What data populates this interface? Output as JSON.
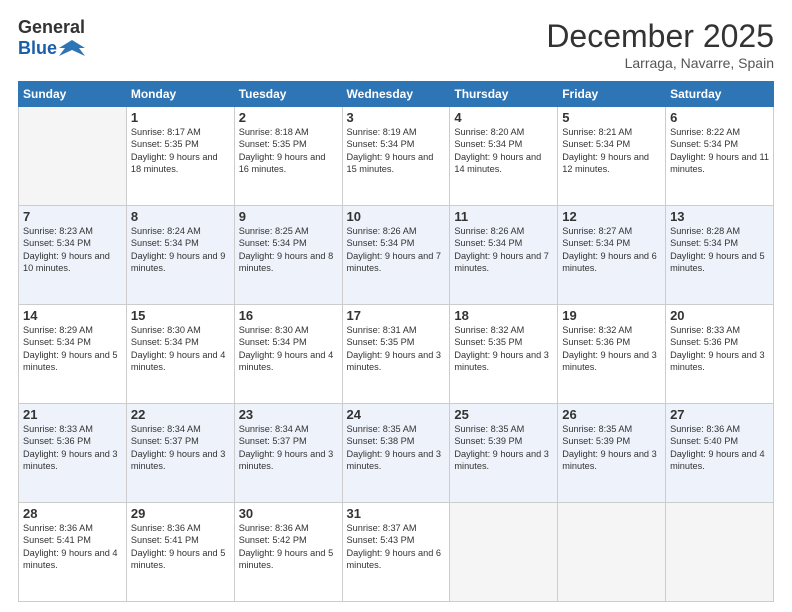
{
  "header": {
    "logo_general": "General",
    "logo_blue": "Blue",
    "month": "December 2025",
    "location": "Larraga, Navarre, Spain"
  },
  "weekdays": [
    "Sunday",
    "Monday",
    "Tuesday",
    "Wednesday",
    "Thursday",
    "Friday",
    "Saturday"
  ],
  "weeks": [
    [
      {
        "day": "",
        "sunrise": "",
        "sunset": "",
        "daylight": ""
      },
      {
        "day": "1",
        "sunrise": "Sunrise: 8:17 AM",
        "sunset": "Sunset: 5:35 PM",
        "daylight": "Daylight: 9 hours and 18 minutes."
      },
      {
        "day": "2",
        "sunrise": "Sunrise: 8:18 AM",
        "sunset": "Sunset: 5:35 PM",
        "daylight": "Daylight: 9 hours and 16 minutes."
      },
      {
        "day": "3",
        "sunrise": "Sunrise: 8:19 AM",
        "sunset": "Sunset: 5:34 PM",
        "daylight": "Daylight: 9 hours and 15 minutes."
      },
      {
        "day": "4",
        "sunrise": "Sunrise: 8:20 AM",
        "sunset": "Sunset: 5:34 PM",
        "daylight": "Daylight: 9 hours and 14 minutes."
      },
      {
        "day": "5",
        "sunrise": "Sunrise: 8:21 AM",
        "sunset": "Sunset: 5:34 PM",
        "daylight": "Daylight: 9 hours and 12 minutes."
      },
      {
        "day": "6",
        "sunrise": "Sunrise: 8:22 AM",
        "sunset": "Sunset: 5:34 PM",
        "daylight": "Daylight: 9 hours and 11 minutes."
      }
    ],
    [
      {
        "day": "7",
        "sunrise": "Sunrise: 8:23 AM",
        "sunset": "Sunset: 5:34 PM",
        "daylight": "Daylight: 9 hours and 10 minutes."
      },
      {
        "day": "8",
        "sunrise": "Sunrise: 8:24 AM",
        "sunset": "Sunset: 5:34 PM",
        "daylight": "Daylight: 9 hours and 9 minutes."
      },
      {
        "day": "9",
        "sunrise": "Sunrise: 8:25 AM",
        "sunset": "Sunset: 5:34 PM",
        "daylight": "Daylight: 9 hours and 8 minutes."
      },
      {
        "day": "10",
        "sunrise": "Sunrise: 8:26 AM",
        "sunset": "Sunset: 5:34 PM",
        "daylight": "Daylight: 9 hours and 7 minutes."
      },
      {
        "day": "11",
        "sunrise": "Sunrise: 8:26 AM",
        "sunset": "Sunset: 5:34 PM",
        "daylight": "Daylight: 9 hours and 7 minutes."
      },
      {
        "day": "12",
        "sunrise": "Sunrise: 8:27 AM",
        "sunset": "Sunset: 5:34 PM",
        "daylight": "Daylight: 9 hours and 6 minutes."
      },
      {
        "day": "13",
        "sunrise": "Sunrise: 8:28 AM",
        "sunset": "Sunset: 5:34 PM",
        "daylight": "Daylight: 9 hours and 5 minutes."
      }
    ],
    [
      {
        "day": "14",
        "sunrise": "Sunrise: 8:29 AM",
        "sunset": "Sunset: 5:34 PM",
        "daylight": "Daylight: 9 hours and 5 minutes."
      },
      {
        "day": "15",
        "sunrise": "Sunrise: 8:30 AM",
        "sunset": "Sunset: 5:34 PM",
        "daylight": "Daylight: 9 hours and 4 minutes."
      },
      {
        "day": "16",
        "sunrise": "Sunrise: 8:30 AM",
        "sunset": "Sunset: 5:34 PM",
        "daylight": "Daylight: 9 hours and 4 minutes."
      },
      {
        "day": "17",
        "sunrise": "Sunrise: 8:31 AM",
        "sunset": "Sunset: 5:35 PM",
        "daylight": "Daylight: 9 hours and 3 minutes."
      },
      {
        "day": "18",
        "sunrise": "Sunrise: 8:32 AM",
        "sunset": "Sunset: 5:35 PM",
        "daylight": "Daylight: 9 hours and 3 minutes."
      },
      {
        "day": "19",
        "sunrise": "Sunrise: 8:32 AM",
        "sunset": "Sunset: 5:36 PM",
        "daylight": "Daylight: 9 hours and 3 minutes."
      },
      {
        "day": "20",
        "sunrise": "Sunrise: 8:33 AM",
        "sunset": "Sunset: 5:36 PM",
        "daylight": "Daylight: 9 hours and 3 minutes."
      }
    ],
    [
      {
        "day": "21",
        "sunrise": "Sunrise: 8:33 AM",
        "sunset": "Sunset: 5:36 PM",
        "daylight": "Daylight: 9 hours and 3 minutes."
      },
      {
        "day": "22",
        "sunrise": "Sunrise: 8:34 AM",
        "sunset": "Sunset: 5:37 PM",
        "daylight": "Daylight: 9 hours and 3 minutes."
      },
      {
        "day": "23",
        "sunrise": "Sunrise: 8:34 AM",
        "sunset": "Sunset: 5:37 PM",
        "daylight": "Daylight: 9 hours and 3 minutes."
      },
      {
        "day": "24",
        "sunrise": "Sunrise: 8:35 AM",
        "sunset": "Sunset: 5:38 PM",
        "daylight": "Daylight: 9 hours and 3 minutes."
      },
      {
        "day": "25",
        "sunrise": "Sunrise: 8:35 AM",
        "sunset": "Sunset: 5:39 PM",
        "daylight": "Daylight: 9 hours and 3 minutes."
      },
      {
        "day": "26",
        "sunrise": "Sunrise: 8:35 AM",
        "sunset": "Sunset: 5:39 PM",
        "daylight": "Daylight: 9 hours and 3 minutes."
      },
      {
        "day": "27",
        "sunrise": "Sunrise: 8:36 AM",
        "sunset": "Sunset: 5:40 PM",
        "daylight": "Daylight: 9 hours and 4 minutes."
      }
    ],
    [
      {
        "day": "28",
        "sunrise": "Sunrise: 8:36 AM",
        "sunset": "Sunset: 5:41 PM",
        "daylight": "Daylight: 9 hours and 4 minutes."
      },
      {
        "day": "29",
        "sunrise": "Sunrise: 8:36 AM",
        "sunset": "Sunset: 5:41 PM",
        "daylight": "Daylight: 9 hours and 5 minutes."
      },
      {
        "day": "30",
        "sunrise": "Sunrise: 8:36 AM",
        "sunset": "Sunset: 5:42 PM",
        "daylight": "Daylight: 9 hours and 5 minutes."
      },
      {
        "day": "31",
        "sunrise": "Sunrise: 8:37 AM",
        "sunset": "Sunset: 5:43 PM",
        "daylight": "Daylight: 9 hours and 6 minutes."
      },
      {
        "day": "",
        "sunrise": "",
        "sunset": "",
        "daylight": ""
      },
      {
        "day": "",
        "sunrise": "",
        "sunset": "",
        "daylight": ""
      },
      {
        "day": "",
        "sunrise": "",
        "sunset": "",
        "daylight": ""
      }
    ]
  ]
}
